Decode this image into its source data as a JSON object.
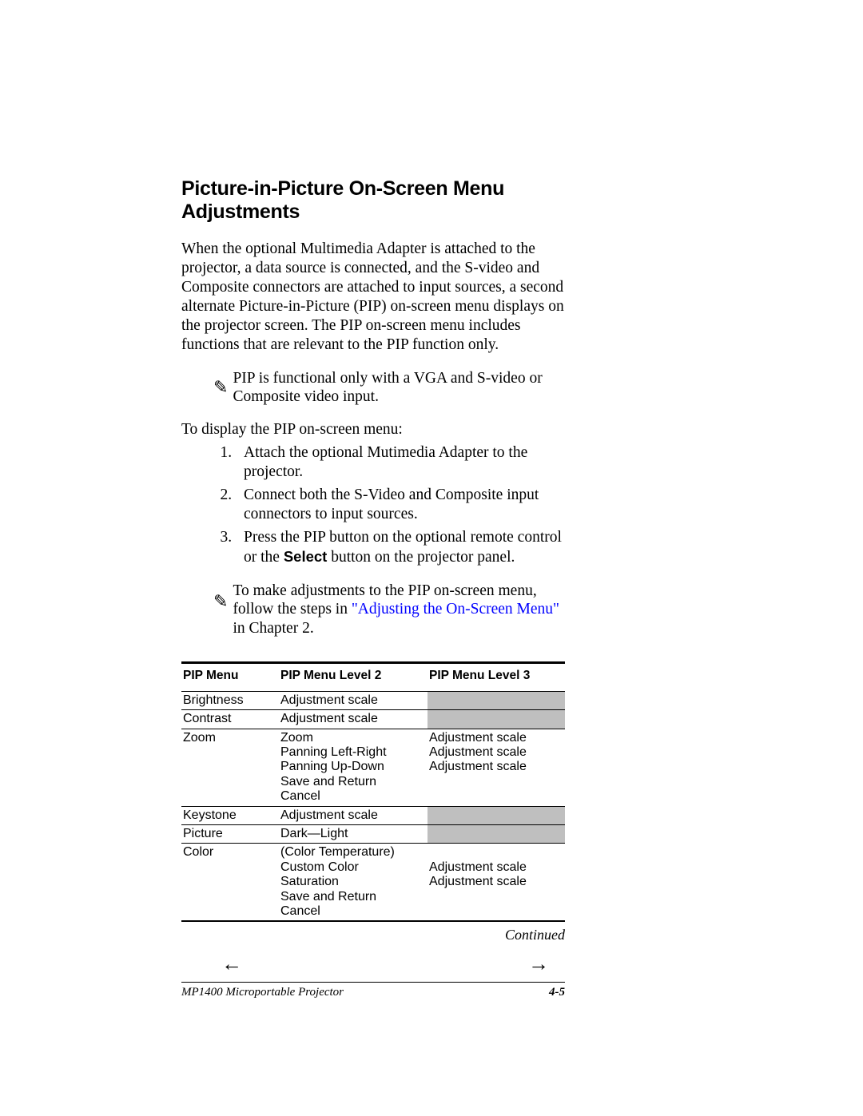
{
  "heading": "Picture-in-Picture On-Screen Menu Adjustments",
  "intro": "When the optional Multimedia Adapter is attached to the projector, a data source is connected, and the S-video and Composite connectors are attached to input sources, a second alternate Picture-in-Picture (PIP) on-screen menu displays on the projector screen. The PIP on-screen menu includes functions that are relevant to the PIP function only.",
  "note1": "PIP is functional only with a VGA and S-video or Composite video input.",
  "lead": "To display the PIP on-screen menu:",
  "steps": {
    "s1": "Attach the optional Mutimedia Adapter to the projector.",
    "s2": "Connect both the S-Video and Composite input connectors to input sources.",
    "s3a": "Press the PIP button on the optional remote control or the ",
    "s3b": "Select",
    "s3c": " button on the projector panel."
  },
  "note2a": "To make adjustments to the PIP on-screen menu, follow the steps in ",
  "note2link": "\"Adjusting the On-Screen Menu\"",
  "note2b": " in Chapter 2.",
  "table": {
    "h1": "PIP Menu",
    "h2": "PIP Menu Level 2",
    "h3": "PIP Menu Level 3",
    "r1c1": "Brightness",
    "r1c2": "Adjustment scale",
    "r2c1": "Contrast",
    "r2c2": "Adjustment scale",
    "r3c1": "Zoom",
    "r3c2": "Zoom\nPanning Left-Right\nPanning Up-Down\nSave and Return\nCancel",
    "r3c3": "Adjustment scale\nAdjustment scale\nAdjustment scale",
    "r4c1": "Keystone",
    "r4c2": "Adjustment scale",
    "r5c1": "Picture",
    "r5c2": "Dark—Light",
    "r6c1": "Color",
    "r6c2": "(Color Temperature)\nCustom Color\nSaturation\nSave and Return\nCancel",
    "r6c3": "\nAdjustment scale\nAdjustment scale"
  },
  "continued": "Continued",
  "footer_left": "MP1400 Microportable Projector",
  "footer_right": "4-5"
}
